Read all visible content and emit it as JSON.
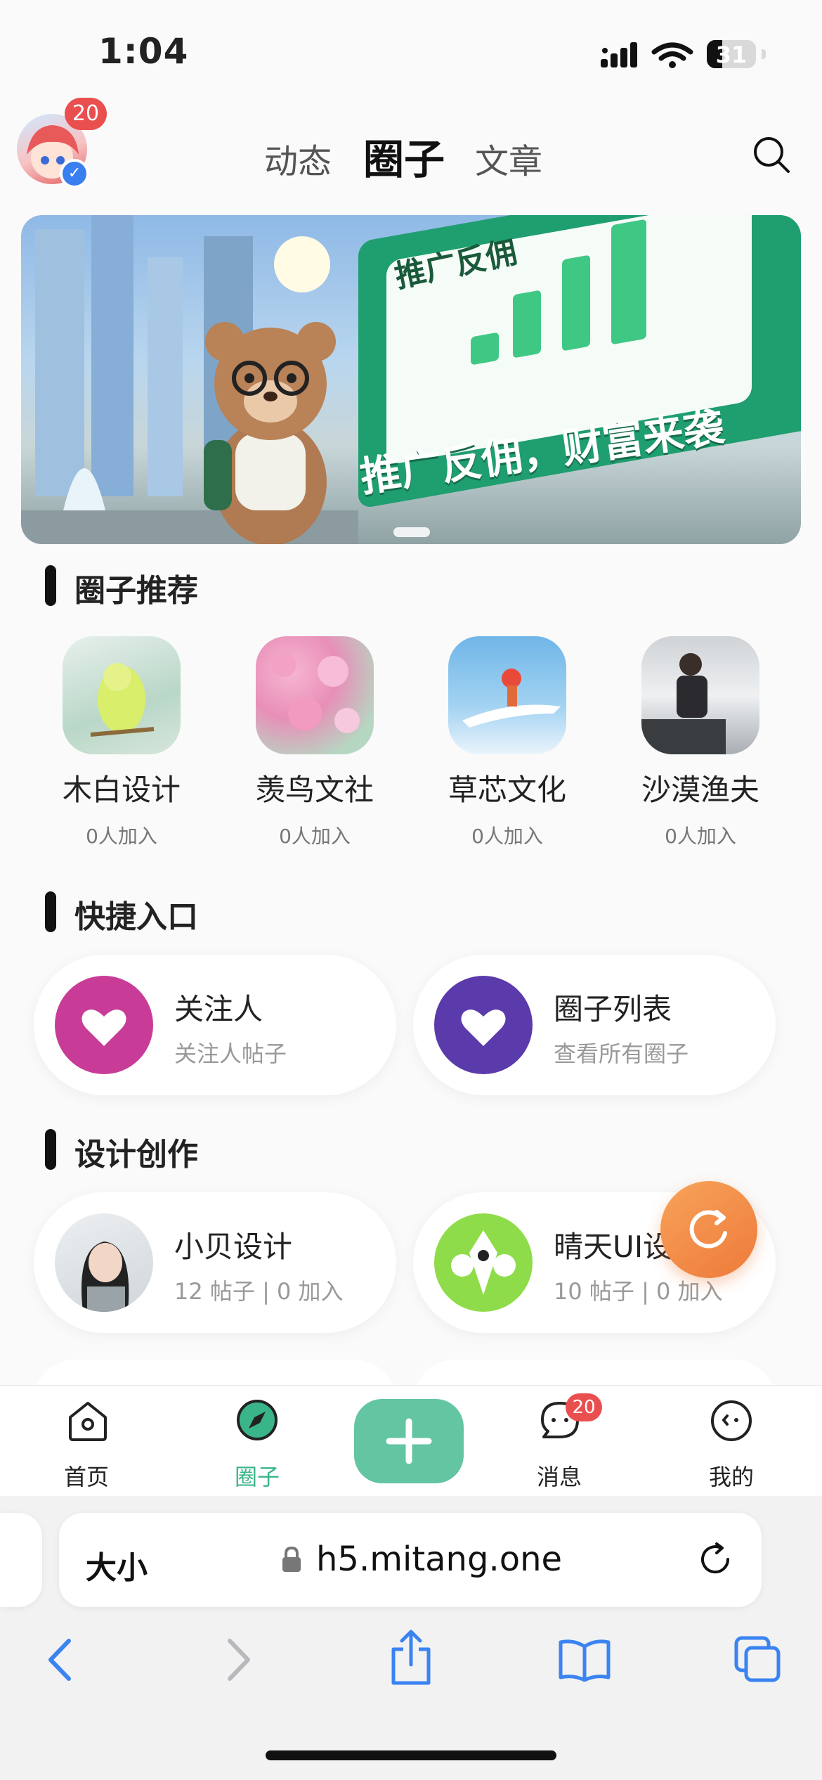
{
  "status_bar": {
    "time": "1:04",
    "battery": "31"
  },
  "header": {
    "avatar_badge": "20",
    "tabs": [
      {
        "label": "动态",
        "active": false
      },
      {
        "label": "圈子",
        "active": true
      },
      {
        "label": "文章",
        "active": false
      }
    ]
  },
  "banner": {
    "board_title": "推广反佣",
    "caption": "推广反佣，财富来袭"
  },
  "recommend": {
    "title": "圈子推荐",
    "items": [
      {
        "name": "木白设计",
        "count": "0人加入"
      },
      {
        "name": "羡鸟文社",
        "count": "0人加入"
      },
      {
        "name": "草芯文化",
        "count": "0人加入"
      },
      {
        "name": "沙漠渔夫",
        "count": "0人加入"
      }
    ]
  },
  "shortcuts": {
    "title": "快捷入口",
    "items": [
      {
        "title": "关注人",
        "subtitle": "关注人帖子",
        "color": "#c83c97"
      },
      {
        "title": "圈子列表",
        "subtitle": "查看所有圈子",
        "color": "#5b3aab"
      }
    ]
  },
  "design": {
    "title": "设计创作",
    "items": [
      {
        "title": "小贝设计",
        "subtitle": "12 帖子 | 0 加入"
      },
      {
        "title": "晴天UI设",
        "subtitle": "10 帖子 | 0 加入"
      }
    ]
  },
  "bottom_nav": {
    "items": [
      {
        "label": "首页",
        "active": false
      },
      {
        "label": "圈子",
        "active": true
      },
      {
        "label": "消息",
        "active": false,
        "badge": "20"
      },
      {
        "label": "我的",
        "active": false
      }
    ],
    "active_color": "#3ab589"
  },
  "browser": {
    "text_size": "大小",
    "url": "h5.mitang.one"
  }
}
